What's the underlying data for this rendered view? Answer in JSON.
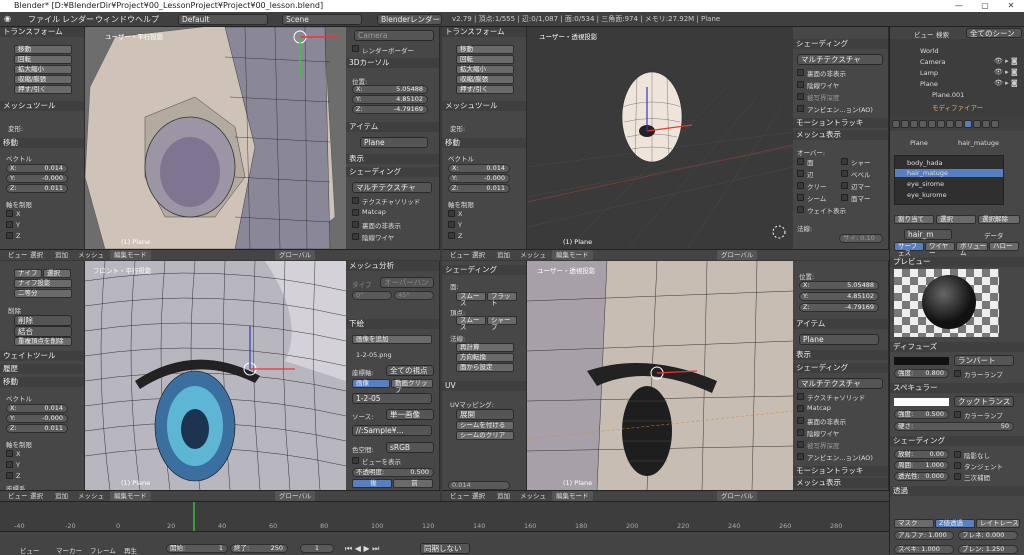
{
  "window": {
    "title": "Blender* [D:¥BlenderDir¥Project¥00_LessonProject¥Project¥00_lesson.blend]",
    "min": "—",
    "max": "▢",
    "close": "✕"
  },
  "info": {
    "menus": [
      "ファイル",
      "レンダー",
      "ウィンドウ",
      "ヘルプ"
    ],
    "layout": "Default",
    "scene": "Scene",
    "engine": "Blenderレンダー",
    "stats": "v2.79 | 頂点:1/555 | 辺:0/1,087 | 面:0/534 | 三角面:974 | メモリ:27.92M | Plane"
  },
  "tl_panel": {
    "transform": "トランスフォーム",
    "move": "移動",
    "rotate": "回転",
    "scale": "拡大縮小",
    "shrink": "収縮/膨張",
    "push": "押す/引く",
    "mesh_tools": "メッシュツール",
    "deform": "変形:",
    "op": "移動",
    "vector": "ベクトル",
    "x": "X:",
    "xv": "0.014",
    "y": "Y:",
    "yv": "-0.000",
    "z": "Z:",
    "zv": "0.011",
    "constraint": "軸を制限",
    "cx": "X",
    "cy": "Y",
    "cz": "Z"
  },
  "vp_tl": {
    "label": "ユーザー・平行投影",
    "status": "(1) Plane"
  },
  "props_tl": {
    "camera": "Camera",
    "render_border": "レンダーボーダー",
    "cursor": "3Dカーソル",
    "location": "位置:",
    "x": "X:",
    "xv": "5.05488",
    "y": "Y:",
    "yv": "4.85102",
    "z": "Z:",
    "zv": "-4.79169",
    "item": "アイテム",
    "plane": "Plane",
    "display": "表示",
    "shading": "シェーディング",
    "shading_mode": "マルチテクスチャ",
    "textured_solid": "テクスチャソリッド",
    "matcap": "Matcap",
    "backface": "裏面の非表示",
    "hidden_wire": "陰線ワイヤ"
  },
  "tr_panel": {
    "transform": "トランスフォーム",
    "move": "移動",
    "rotate": "回転",
    "scale": "拡大縮小",
    "shrink": "収縮/膨張",
    "push": "押す/引く",
    "mesh_tools": "メッシュツール",
    "deform": "変形:",
    "op": "移動",
    "vector": "ベクトル",
    "x": "X:",
    "xv": "0.014",
    "y": "Y:",
    "yv": "-0.000",
    "z": "Z:",
    "zv": "0.011",
    "constraint": "軸を制限",
    "cx": "X",
    "cy": "Y",
    "cz": "Z"
  },
  "vp_tr": {
    "label": "ユーザー・透視投影",
    "status": "(1) Plane"
  },
  "props_tr": {
    "shading": "シェーディング",
    "mode": "マルチテクスチャ",
    "backface": "裏面の非表示",
    "hidden_wire": "陰線ワイヤ",
    "depth": "被写界深度",
    "ao": "アンビエン...ョン(AO)",
    "motion": "モーショントラッキ",
    "mesh_display": "メッシュ表示",
    "overlay": "オーバー:",
    "face": "面",
    "sharp": "シャー",
    "edge": "辺",
    "bevel": "ベベル",
    "crease": "クリー",
    "edge_marks": "辺マー",
    "seam": "シーム",
    "face_marks": "面マー",
    "weight": "ウェイト表示",
    "normal": "法線:",
    "size": "サイ: 0.10"
  },
  "outliner": {
    "view": "ビュー",
    "search": "検索",
    "scope": "全てのシーン",
    "items": [
      "World",
      "Camera",
      "Lamp",
      "Plane",
      "Plane.001",
      "モディファイアー"
    ]
  },
  "props_right": {
    "object": "Plane",
    "material": "hair_matuge",
    "mats": [
      "body_hada",
      "hair_matuge",
      "eye_sirome",
      "eye_kurome"
    ],
    "assign": "割り当て",
    "select": "選択",
    "deselect": "選択解除",
    "matname": "hair_m",
    "data": "データ",
    "tab_surface": "サーフェス",
    "tab_wire": "ワイヤー",
    "tab_volume": "ボリューム",
    "tab_halo": "ハロー",
    "preview": "プレビュー",
    "diffuse": "ディフューズ",
    "lambert": "ランバート",
    "intensity": "強度:",
    "diff_val": "0.800",
    "ramp": "カラーランプ",
    "specular": "スペキュラー",
    "cooktorr": "クックトランス",
    "spec_val": "0.500",
    "hard": "硬さ:",
    "hard_val": "50",
    "shading": "シェーディング",
    "emit": "放射:",
    "emit_val": "0.00",
    "shadeless": "陰影なし",
    "ambient": "周囲:",
    "amb_val": "1.000",
    "tangent": "タンジェント",
    "translucency": "透光性:",
    "trans_val": "0.000",
    "cubic": "三次補間",
    "transparency": "透過",
    "mask": "マスク",
    "z_transp": "Z値透過",
    "raytrace": "レイトレース",
    "alpha": "アルファ: 1.000",
    "fresnel": "フレネ: 0.000",
    "spec_a": "スペキ: 1.000",
    "blend": "ブレン: 1.250"
  },
  "bl_panel": {
    "knife": "ナイフ",
    "select": "選択",
    "knife_project": "ナイフ投影",
    "bisect": "二等分",
    "remove": "削除",
    "delete": "削除",
    "dissolve": "結合",
    "remove_doubles": "重複頂点を削除",
    "weight": "ウェイトツール",
    "history": "履歴",
    "op": "移動",
    "vector": "ベクトル",
    "x": "X:",
    "xv": "0.014",
    "y": "Y:",
    "yv": "-0.000",
    "z": "Z:",
    "zv": "0.011",
    "constraint": "軸を制限",
    "cx": "X",
    "cy": "Y",
    "cz": "Z",
    "orient": "座標系"
  },
  "vp_bl": {
    "label": "フロント・平行投影",
    "status": "(1) Plane"
  },
  "props_bl": {
    "mesh_analysis": "メッシュ分析",
    "type": "タイプ",
    "overhang": "オーバーハン",
    "deg0": "0°",
    "deg45": "45°",
    "bg": "下絵",
    "add_image": "画像を追加",
    "image": "1-2-05.png",
    "axis": "座標軸:",
    "all_views": "全ての視点",
    "img_tab": "画像",
    "clip_tab": "動画クリップ",
    "img_name": "1-2-05",
    "source": "ソース:",
    "single": "単一画像",
    "path": "//:Sample¥...",
    "colorspace": "色空間:",
    "srgb": "sRGB",
    "view_as": "ビューを表示",
    "opacity": "不透明度:",
    "opac_val": "0.500",
    "back": "後",
    "front": "前"
  },
  "br_panel": {
    "shading": "シェーディング",
    "faces": "面:",
    "smooth": "スムース",
    "flat": "フラット",
    "vertex": "頂点:",
    "smooth2": "スムース",
    "sharp": "シャープ",
    "normal": "法線:",
    "recalc": "再計算",
    "flip": "方向転換",
    "copy_normal": "面から設定",
    "uv": "UV",
    "uv_mapping": "UVマッピング:",
    "unwrap": "展開",
    "mark_seam": "シームを付ける",
    "clear_seam": "シームのクリア",
    "weight": "0.014"
  },
  "vp_br": {
    "label": "ユーザー・透視投影",
    "status": "(1) Plane"
  },
  "props_br": {
    "location": "位置:",
    "x": "X:",
    "xv": "5.05488",
    "y": "Y:",
    "yv": "4.85102",
    "z": "Z:",
    "zv": "-4.79169",
    "item": "アイテム",
    "plane": "Plane",
    "display": "表示",
    "shading": "シェーディング",
    "mode": "マルチテクスチャ",
    "textured_solid": "テクスチャソリッド",
    "matcap": "Matcap",
    "backface": "裏面の非表示",
    "hidden_wire": "陰線ワイヤ",
    "depth": "被写界深度",
    "ao": "アンビエン...ョン(AO)",
    "motion": "モーショントラッキ",
    "mesh_display": "メッシュ表示"
  },
  "vp_header": {
    "view": "ビュー",
    "select": "選択",
    "add": "追加",
    "mesh": "メッシュ",
    "mode": "編集モード",
    "orient": "グローバル"
  },
  "timeline": {
    "ticks": [
      "-40",
      "-20",
      "0",
      "20",
      "40",
      "60",
      "80",
      "100",
      "120",
      "140",
      "160",
      "180",
      "200",
      "220",
      "240",
      "260",
      "280"
    ],
    "view": "ビュー",
    "marker": "マーカー",
    "frame": "フレーム",
    "play": "再生",
    "start_label": "開始:",
    "start": "1",
    "end_label": "終了:",
    "end": "250",
    "current": "1",
    "sync": "同期しない"
  }
}
